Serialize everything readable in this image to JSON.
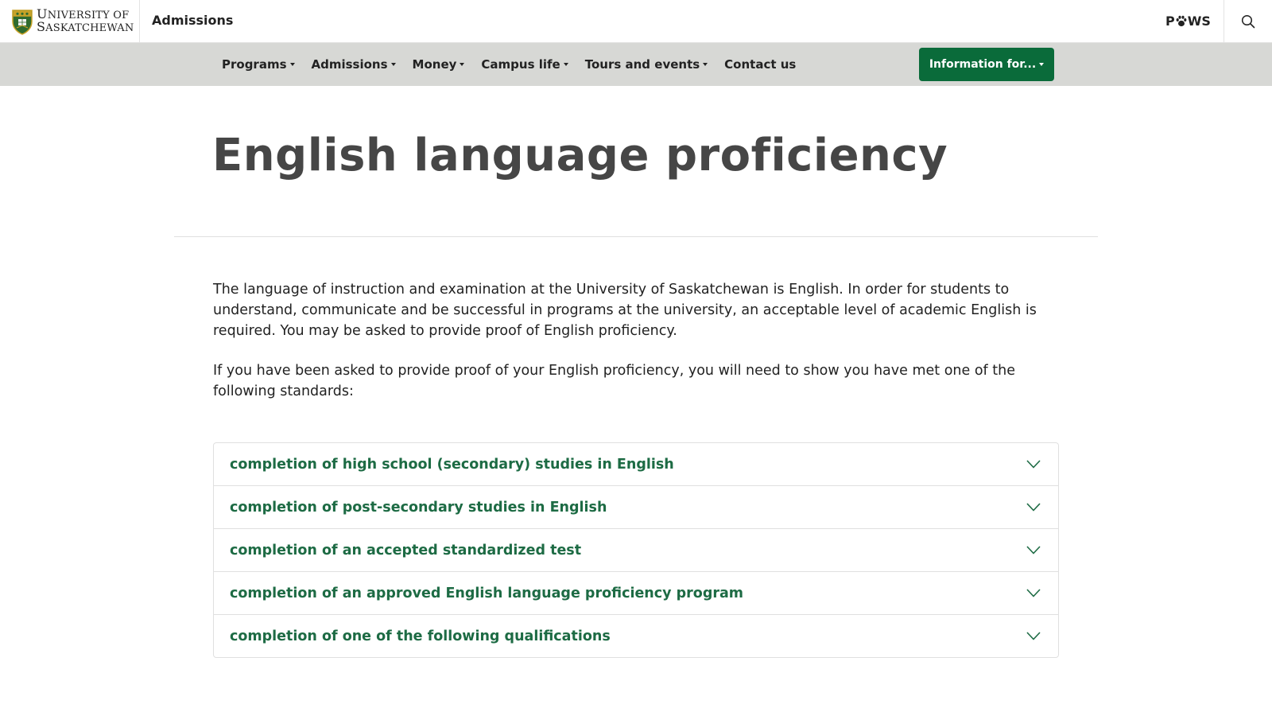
{
  "header": {
    "logo_line1_big": "U",
    "logo_line1_rest": "NIVERSITY OF",
    "logo_line2_big": "S",
    "logo_line2_rest": "ASKATCHEWAN",
    "site_title": "Admissions",
    "paws_p": "P",
    "paws_ws": "WS"
  },
  "nav": {
    "items": [
      {
        "label": "Programs",
        "dropdown": true
      },
      {
        "label": "Admissions",
        "dropdown": true
      },
      {
        "label": "Money",
        "dropdown": true
      },
      {
        "label": "Campus life",
        "dropdown": true
      },
      {
        "label": "Tours and events",
        "dropdown": true
      },
      {
        "label": "Contact us",
        "dropdown": false
      }
    ],
    "info_button": "Information for..."
  },
  "main": {
    "title": "English language proficiency",
    "paragraphs": [
      "The language of instruction and examination at the University of Saskatchewan is English. In order for students to understand, communicate and be successful in programs at the university, an acceptable level of academic English is required. You may be asked to provide proof of English proficiency.",
      "If you have been asked to provide proof of your English proficiency, you will need to show you have met one of the following standards:"
    ],
    "accordion": [
      "completion of high school (secondary) studies in English",
      "completion of post-secondary studies in English",
      "completion of an accepted standardized test",
      "completion of an approved English language proficiency program",
      "completion of one of the following qualifications"
    ]
  },
  "colors": {
    "brand_green": "#0a6b3a",
    "accordion_text": "#1d6b44",
    "navbar_bg": "#d7d8d5",
    "title_gray": "#464646"
  },
  "icons": {
    "logo": "university-crest-icon",
    "paws": "paw-icon",
    "search": "search-icon",
    "accordion": "chevron-down-icon",
    "nav_dropdown": "caret-down-icon"
  }
}
